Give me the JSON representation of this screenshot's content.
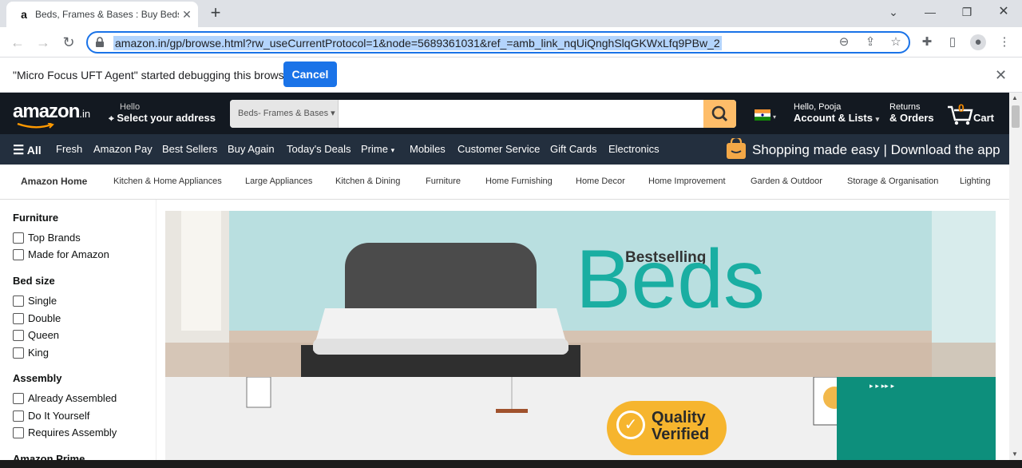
{
  "browser": {
    "tab_title": "Beds, Frames & Bases : Buy Beds",
    "tab_favicon": "a",
    "url": "amazon.in/gp/browse.html?rw_useCurrentProtocol=1&node=5689361031&ref_=amb_link_nqUiQnghSlqGKWxLfq9PBw_2"
  },
  "debug_bar": {
    "message": "\"Micro Focus UFT Agent\" started debugging this browser",
    "cancel_label": "Cancel"
  },
  "header": {
    "logo_text": "amazon",
    "logo_suffix": ".in",
    "hello": "Hello",
    "select_address": "Select your address",
    "search_category": "Beds- Frames & Bases",
    "account_greeting": "Hello, Pooja",
    "account_lists": "Account & Lists",
    "returns": "Returns",
    "orders": "& Orders",
    "cart_count": "0",
    "cart_label": "Cart"
  },
  "nav": {
    "all": "All",
    "items": [
      "Fresh",
      "Amazon Pay",
      "Best Sellers",
      "Buy Again",
      "Today's Deals",
      "Prime",
      "Mobiles",
      "Customer Service",
      "Gift Cards",
      "Electronics"
    ],
    "app_banner": "Shopping made easy | Download the app"
  },
  "subnav": {
    "home": "Amazon Home",
    "items": [
      "Kitchen & Home Appliances",
      "Large Appliances",
      "Kitchen & Dining",
      "Furniture",
      "Home Furnishing",
      "Home Decor",
      "Home Improvement",
      "Garden & Outdoor",
      "Storage & Organisation",
      "Lighting"
    ]
  },
  "sidebar": {
    "furniture_heading": "Furniture",
    "furniture_options": [
      "Top Brands",
      "Made for Amazon"
    ],
    "bed_size_heading": "Bed size",
    "bed_size_options": [
      "Single",
      "Double",
      "Queen",
      "King"
    ],
    "assembly_heading": "Assembly",
    "assembly_options": [
      "Already Assembled",
      "Do It Yourself",
      "Requires Assembly"
    ],
    "prime_heading": "Amazon Prime"
  },
  "banner": {
    "kicker": "Bestselling",
    "headline": "Beds",
    "badge_line1": "Quality",
    "badge_line2": "Verified"
  },
  "colors": {
    "amazon_dark": "#131921",
    "amazon_nav": "#232f3e",
    "search_button": "#febd69",
    "chrome_blue": "#1a73e8",
    "beds_teal": "#1aaea2"
  }
}
